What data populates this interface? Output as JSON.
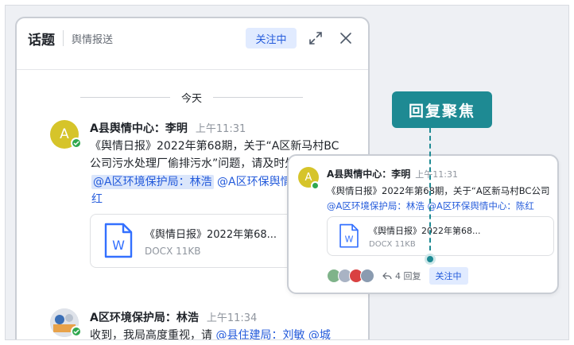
{
  "panel": {
    "title": "话题",
    "subtitle": "舆情报送",
    "follow_label": "关注中",
    "day_divider": "今天"
  },
  "message1": {
    "avatar_letter": "A",
    "sender": "A县舆情中心：李明",
    "time": "上午11:31",
    "line1": "《舆情日报》2022年第68期，关于“A区新马村BC",
    "line2": "公司污水处理厂偷排污水”问题，请及时处置",
    "mention1": "@A区环境保护局：林浩",
    "mention2": "@A区环保舆情中心：陈",
    "mention2_tail": "红",
    "file": {
      "name": "《舆情日报》2022年第68...",
      "meta": "DOCX 11KB",
      "icon_letter": "W"
    }
  },
  "message2": {
    "sender": "A区环境保护局：林浩",
    "time": "上午11:34",
    "text": "收到，我局高度重视，请",
    "mention": "@县住建局：刘敏 @城"
  },
  "zoom_card": {
    "avatar_letter": "A",
    "sender": "A县舆情中心：李明",
    "time": "上午11:31",
    "text": "《舆情日报》2022年第68期，关于“A区新马村BC公司",
    "mentions": "@A区环境保护局：林浩 @A区环保舆情中心：陈红",
    "file": {
      "name": "《舆情日报》2022年第68...",
      "meta": "DOCX 11KB",
      "icon_letter": "W"
    },
    "reply_count": "4 回复",
    "follow_label": "关注中"
  },
  "callout": {
    "label": "回复聚焦"
  },
  "colors": {
    "accent": "#245bdb",
    "callout": "#1e8a93",
    "online": "#2fa84f",
    "avatar": "#d6c42a"
  }
}
